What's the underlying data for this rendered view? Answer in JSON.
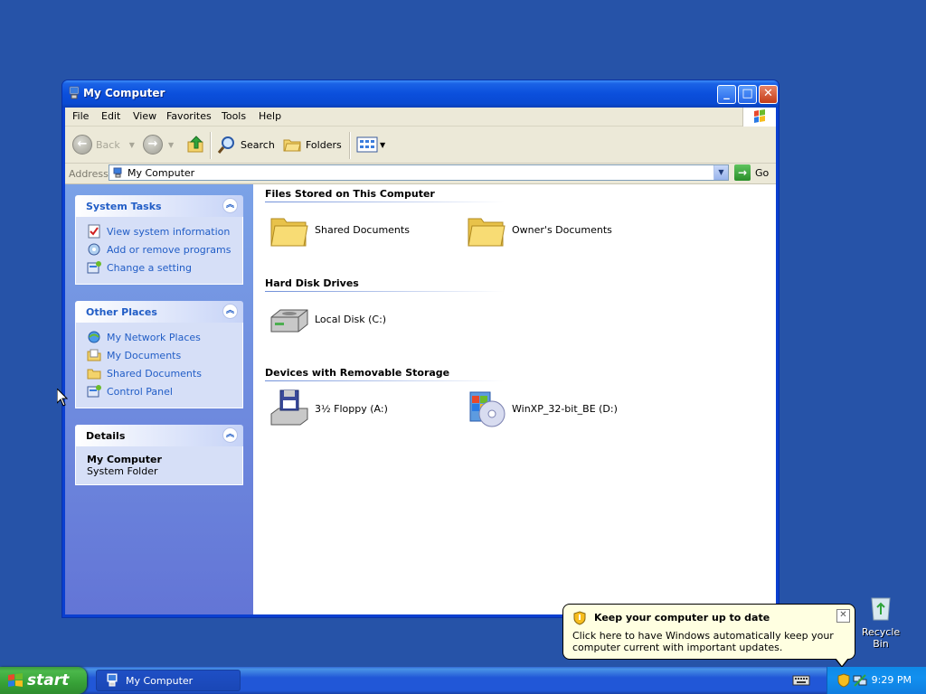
{
  "window": {
    "title": "My Computer",
    "controls": {
      "minimize": "_",
      "maximize": "□",
      "close": "✕"
    }
  },
  "menu": [
    "File",
    "Edit",
    "View",
    "Favorites",
    "Tools",
    "Help"
  ],
  "toolbar": {
    "back": "Back",
    "search": "Search",
    "folders": "Folders"
  },
  "address": {
    "label": "Address",
    "value": "My Computer",
    "go": "Go"
  },
  "taskpane": {
    "system_tasks": {
      "title": "System Tasks",
      "items": [
        "View system information",
        "Add or remove programs",
        "Change a setting"
      ]
    },
    "other_places": {
      "title": "Other Places",
      "items": [
        "My Network Places",
        "My Documents",
        "Shared Documents",
        "Control Panel"
      ]
    },
    "details": {
      "title": "Details",
      "name": "My Computer",
      "type": "System Folder"
    }
  },
  "content": {
    "groups": [
      {
        "title": "Files Stored on This Computer",
        "items": [
          "Shared Documents",
          "Owner's Documents"
        ]
      },
      {
        "title": "Hard Disk Drives",
        "items": [
          "Local Disk (C:)"
        ]
      },
      {
        "title": "Devices with Removable Storage",
        "items": [
          "3½ Floppy (A:)",
          "WinXP_32-bit_BE (D:)"
        ]
      }
    ]
  },
  "balloon": {
    "title": "Keep your computer up to date",
    "text": "Click here to have Windows automatically keep your computer current with important updates.",
    "close": "✕"
  },
  "desktop": {
    "recycle_bin": "Recycle Bin"
  },
  "taskbar": {
    "start": "start",
    "task": "My Computer",
    "clock": "9:29 PM"
  },
  "colors": {
    "desktop": "#2653a8",
    "link": "#215dc6",
    "taskbar": "#2157d7",
    "start": "#37a137",
    "balloon": "#ffffe1"
  }
}
